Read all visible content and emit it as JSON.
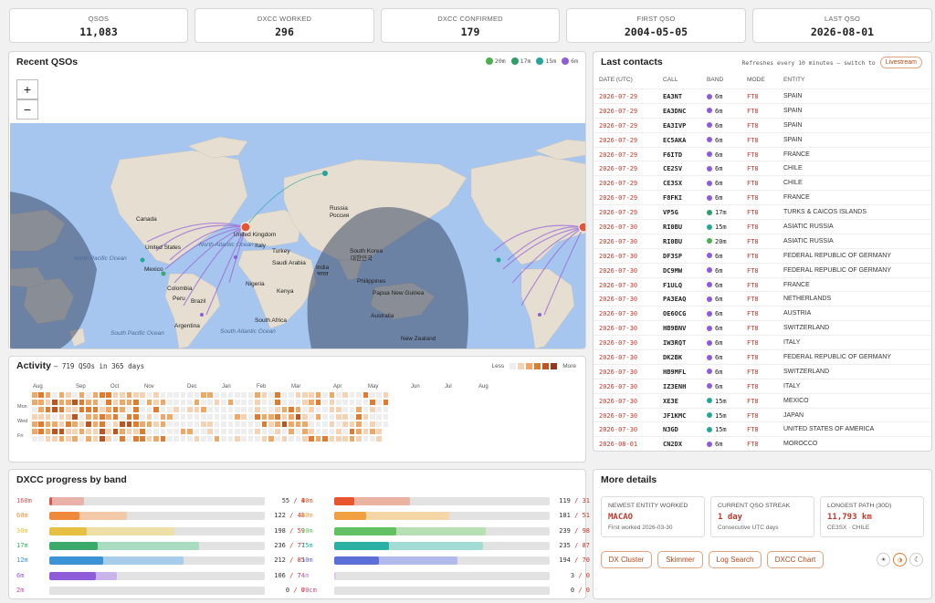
{
  "stats": [
    {
      "label": "QSOS",
      "value": "11,083"
    },
    {
      "label": "DXCC WORKED",
      "value": "296"
    },
    {
      "label": "DXCC CONFIRMED",
      "value": "179"
    },
    {
      "label": "FIRST QSO",
      "value": "2004-05-05"
    },
    {
      "label": "LAST QSO",
      "value": "2026-08-01"
    }
  ],
  "recent": {
    "title": "Recent QSOs",
    "legend": [
      {
        "band": "20m",
        "color": "#4caf50"
      },
      {
        "band": "17m",
        "color": "#2e9e6b"
      },
      {
        "band": "15m",
        "color": "#26a69a"
      },
      {
        "band": "6m",
        "color": "#8e5cd9"
      }
    ],
    "zoom_in": "+",
    "zoom_out": "−",
    "map_labels": [
      "Canada",
      "United States",
      "Mexico",
      "Colombia",
      "Peru",
      "Brazil",
      "Argentina",
      "North Atlantic Ocean",
      "South Atlantic Ocean",
      "United Kingdom",
      "Italy",
      "Turkey",
      "Saudi Arabia",
      "Nigeria",
      "Kenya",
      "South Africa",
      "Russia",
      "Россия",
      "India",
      "भारत",
      "South Korea",
      "대한민국",
      "Philippines",
      "Papua New Guinea",
      "Australia",
      "New Zealand",
      "North Pacific Ocean",
      "South Pacific Ocean"
    ]
  },
  "activity": {
    "title": "Activity",
    "subtitle": "719 QSOs in 365 days",
    "less": "Less",
    "more": "More",
    "months": [
      "Aug",
      "Sep",
      "Oct",
      "Nov",
      "Dec",
      "Jan",
      "Feb",
      "Mar",
      "Apr",
      "May",
      "Jun",
      "Jul",
      "Aug"
    ],
    "days": [
      "Mon",
      "Wed",
      "Fri"
    ],
    "scale": [
      "#eeeeee",
      "#f6d2b4",
      "#f0a867",
      "#e07b30",
      "#c0531e",
      "#96361a"
    ]
  },
  "last": {
    "title": "Last contacts",
    "refresh": "Refreshes every 10 minutes — switch to",
    "live": "Livestream",
    "headers": [
      "DATE (UTC)",
      "CALL",
      "BAND",
      "MODE",
      "ENTITY"
    ],
    "rows": [
      [
        "2026-07-29",
        "EA3NT",
        "6m",
        "FT8",
        "SPAIN"
      ],
      [
        "2026-07-29",
        "EA3DNC",
        "6m",
        "FT8",
        "SPAIN"
      ],
      [
        "2026-07-29",
        "EA3IVP",
        "6m",
        "FT8",
        "SPAIN"
      ],
      [
        "2026-07-29",
        "EC5AKA",
        "6m",
        "FT8",
        "SPAIN"
      ],
      [
        "2026-07-29",
        "F6ITD",
        "6m",
        "FT8",
        "FRANCE"
      ],
      [
        "2026-07-29",
        "CE2SV",
        "6m",
        "FT8",
        "CHILE"
      ],
      [
        "2026-07-29",
        "CE3SX",
        "6m",
        "FT8",
        "CHILE"
      ],
      [
        "2026-07-29",
        "F8FKI",
        "6m",
        "FT8",
        "FRANCE"
      ],
      [
        "2026-07-29",
        "VP5G",
        "17m",
        "FT8",
        "TURKS & CAICOS ISLANDS"
      ],
      [
        "2026-07-30",
        "RI0BU",
        "15m",
        "FT8",
        "ASIATIC RUSSIA"
      ],
      [
        "2026-07-30",
        "RI0BU",
        "20m",
        "FT8",
        "ASIATIC RUSSIA"
      ],
      [
        "2026-07-30",
        "DF3SP",
        "6m",
        "FT8",
        "FEDERAL REPUBLIC OF GERMANY"
      ],
      [
        "2026-07-30",
        "DC9MW",
        "6m",
        "FT8",
        "FEDERAL REPUBLIC OF GERMANY"
      ],
      [
        "2026-07-30",
        "F1ULQ",
        "6m",
        "FT8",
        "FRANCE"
      ],
      [
        "2026-07-30",
        "PA3EAQ",
        "6m",
        "FT8",
        "NETHERLANDS"
      ],
      [
        "2026-07-30",
        "OE6OCG",
        "6m",
        "FT8",
        "AUSTRIA"
      ],
      [
        "2026-07-30",
        "HB9BNV",
        "6m",
        "FT8",
        "SWITZERLAND"
      ],
      [
        "2026-07-30",
        "IW3RQT",
        "6m",
        "FT8",
        "ITALY"
      ],
      [
        "2026-07-30",
        "DK2BK",
        "6m",
        "FT8",
        "FEDERAL REPUBLIC OF GERMANY"
      ],
      [
        "2026-07-30",
        "HB9MFL",
        "6m",
        "FT8",
        "SWITZERLAND"
      ],
      [
        "2026-07-30",
        "IZ3ENH",
        "6m",
        "FT8",
        "ITALY"
      ],
      [
        "2026-07-30",
        "XE3E",
        "15m",
        "FT8",
        "MEXICO"
      ],
      [
        "2026-07-30",
        "JF1KMC",
        "15m",
        "FT8",
        "JAPAN"
      ],
      [
        "2026-07-30",
        "N3GD",
        "15m",
        "FT8",
        "UNITED STATES OF AMERICA"
      ],
      [
        "2026-08-01",
        "CN2DX",
        "6m",
        "FT8",
        "MOROCCO"
      ]
    ]
  },
  "dxcc": {
    "title": "DXCC progress by band",
    "bands": [
      {
        "band": "160m",
        "worked": 55,
        "confirmed": 4,
        "color": "#d9534f",
        "light": "#e8b2a8"
      },
      {
        "band": "80m",
        "worked": 119,
        "confirmed": 31,
        "color": "#e8552f",
        "light": "#eab3a2"
      },
      {
        "band": "60m",
        "worked": 122,
        "confirmed": 48,
        "color": "#ef8a3c",
        "light": "#f3c9a8"
      },
      {
        "band": "40m",
        "worked": 181,
        "confirmed": 51,
        "color": "#f0a040",
        "light": "#f5d6a6"
      },
      {
        "band": "30m",
        "worked": 198,
        "confirmed": 59,
        "color": "#e6c040",
        "light": "#eedfa6"
      },
      {
        "band": "20m",
        "worked": 239,
        "confirmed": 98,
        "color": "#63c164",
        "light": "#b8e0b5"
      },
      {
        "band": "17m",
        "worked": 236,
        "confirmed": 77,
        "color": "#3aab6a",
        "light": "#a9dcc0"
      },
      {
        "band": "15m",
        "worked": 235,
        "confirmed": 87,
        "color": "#2ab0a4",
        "light": "#a3dcd5"
      },
      {
        "band": "12m",
        "worked": 212,
        "confirmed": 85,
        "color": "#3c93d6",
        "light": "#a8cdea"
      },
      {
        "band": "10m",
        "worked": 194,
        "confirmed": 70,
        "color": "#5b6fd6",
        "light": "#b2bbec"
      },
      {
        "band": "6m",
        "worked": 106,
        "confirmed": 74,
        "color": "#8e5cd9",
        "light": "#c9b5ec"
      },
      {
        "band": "4m",
        "worked": 3,
        "confirmed": 0,
        "color": "#b58fd9",
        "light": "#ddc9ee"
      },
      {
        "band": "2m",
        "worked": 0,
        "confirmed": 0,
        "color": "#c44da5",
        "light": "#e6b3d9"
      },
      {
        "band": "70cm",
        "worked": 0,
        "confirmed": 0,
        "color": "#d4487a",
        "light": "#ecb3c8"
      }
    ],
    "max": 340
  },
  "more": {
    "title": "More details",
    "cards": [
      {
        "head": "NEWEST ENTITY WORKED",
        "value": "MACAO",
        "sub": "First worked 2026-03-30"
      },
      {
        "head": "CURRENT QSO STREAK",
        "value": "1 day",
        "sub": "Consecutive UTC days"
      },
      {
        "head": "LONGEST PATH (30D)",
        "value": "11,793 km",
        "sub": "CE3SX · CHILE"
      }
    ],
    "links": [
      "DX Cluster",
      "Skimmer",
      "Log Search",
      "DXCC Chart"
    ],
    "theme": [
      "☀",
      "◑",
      "☾"
    ]
  }
}
